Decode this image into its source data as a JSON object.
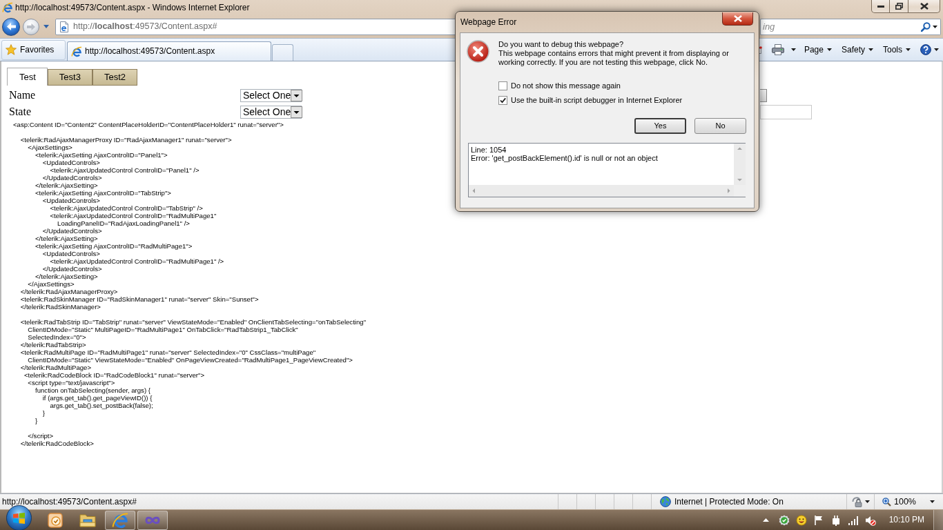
{
  "window": {
    "title": "http://localhost:49573/Content.aspx - Windows Internet Explorer"
  },
  "address_bar": {
    "url": "http://**localhost**:49573/Content.aspx#"
  },
  "search": {
    "placeholder": "ing"
  },
  "favorites": {
    "label": "Favorites"
  },
  "browser_tabs": [
    {
      "label": "http://localhost:49573/Content.aspx",
      "selected": true
    }
  ],
  "command_bar": {
    "menus": [
      "Page",
      "Safety",
      "Tools"
    ]
  },
  "page": {
    "tabs": [
      {
        "label": "Test",
        "selected": true
      },
      {
        "label": "Test3",
        "selected": false
      },
      {
        "label": "Test2",
        "selected": false
      }
    ],
    "fields": [
      {
        "label": "Name",
        "value": "Select One"
      },
      {
        "label": "State",
        "value": "Select One"
      }
    ],
    "code": [
      [
        "<asp:Content ID=\"Content2\" ContentPlaceHolderID=\"ContentPlaceHolder1\" runat=\"server\">"
      ],
      [
        "    <telerik:RadAjaxManagerProxy ID=\"RadAjaxManager1\" runat=\"server\">",
        "        <AjaxSettings>",
        "            <telerik:AjaxSetting AjaxControlID=\"Panel1\">",
        "                <UpdatedControls>",
        "                    <telerik:AjaxUpdatedControl ControlID=\"Panel1\" />",
        "                </UpdatedControls>",
        "            </telerik:AjaxSetting>",
        "            <telerik:AjaxSetting AjaxControlID=\"TabStrip\">",
        "                <UpdatedControls>",
        "                    <telerik:AjaxUpdatedControl ControlID=\"TabStrip\" />",
        "                    <telerik:AjaxUpdatedControl ControlID=\"RadMultiPage1\"",
        "                        LoadingPanelID=\"RadAjaxLoadingPanel1\" />",
        "                </UpdatedControls>",
        "            </telerik:AjaxSetting>",
        "            <telerik:AjaxSetting AjaxControlID=\"RadMultiPage1\">",
        "                <UpdatedControls>",
        "                    <telerik:AjaxUpdatedControl ControlID=\"RadMultiPage1\" />",
        "                </UpdatedControls>",
        "            </telerik:AjaxSetting>",
        "        </AjaxSettings>",
        "    </telerik:RadAjaxManagerProxy>",
        "    <telerik:RadSkinManager ID=\"RadSkinManager1\" runat=\"server\" Skin=\"Sunset\">",
        "    </telerik:RadSkinManager>"
      ],
      [
        "    <telerik:RadTabStrip ID=\"TabStrip\" runat=\"server\" ViewStateMode=\"Enabled\" OnClientTabSelecting=\"onTabSelecting\"",
        "        ClientIDMode=\"Static\" MultiPageID=\"RadMultiPage1\" OnTabClick=\"RadTabStrip1_TabClick\"",
        "        SelectedIndex=\"0\">",
        "    </telerik:RadTabStrip>",
        "    <telerik:RadMultiPage ID=\"RadMultiPage1\" runat=\"server\" SelectedIndex=\"0\" CssClass=\"multiPage\"",
        "        ClientIDMode=\"Static\" ViewStateMode=\"Enabled\" OnPageViewCreated=\"RadMultiPage1_PageViewCreated\">",
        "    </telerik:RadMultiPage>",
        "      <telerik:RadCodeBlock ID=\"RadCodeBlock1\" runat=\"server\">",
        "        <script type=\"text/javascript\">",
        "            function onTabSelecting(sender, args) {",
        "                if (args.get_tab().get_pageViewID()) {",
        "                    args.get_tab().set_postBack(false);",
        "                }",
        "            }"
      ],
      [
        "        </script>",
        "    </telerik:RadCodeBlock>"
      ]
    ]
  },
  "dialog": {
    "title": "Webpage Error",
    "question": "Do you want to debug this webpage?",
    "message_lines": [
      "This webpage contains errors that might prevent it from displaying or",
      "working correctly. If you are not testing this webpage, click No."
    ],
    "checkboxes": [
      {
        "label": "Do not show this message again",
        "checked": false
      },
      {
        "label": "Use the built-in script debugger in Internet Explorer",
        "checked": true
      }
    ],
    "buttons": [
      {
        "label": "Yes",
        "default": true
      },
      {
        "label": "No",
        "default": false
      }
    ],
    "details": [
      "Line: 1054",
      "Error: 'get_postBackElement().id' is null or not an object"
    ]
  },
  "status_bar": {
    "text": "http://localhost:49573/Content.aspx#",
    "zone": "Internet | Protected Mode: On",
    "zoom": "100%"
  },
  "taskbar": {
    "apps": [
      {
        "kind": "note",
        "running": false
      },
      {
        "kind": "folder",
        "running": false
      },
      {
        "kind": "browser",
        "running": true
      },
      {
        "kind": "infinity",
        "running": true
      }
    ],
    "clock": "10:10 PM"
  }
}
